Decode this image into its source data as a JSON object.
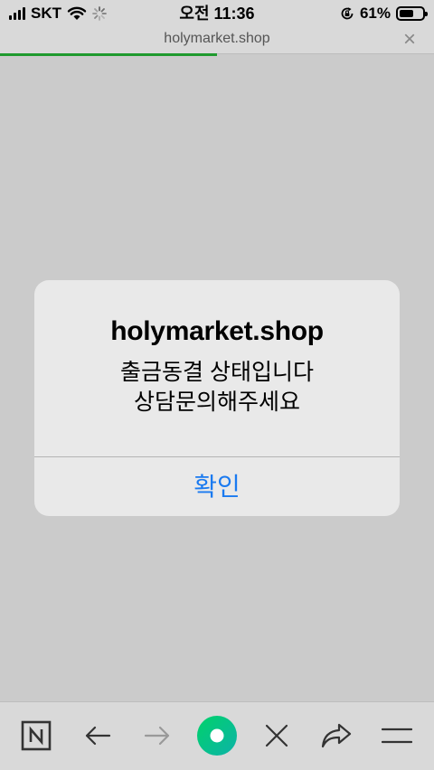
{
  "status_bar": {
    "carrier": "SKT",
    "time": "오전 11:36",
    "battery_percent": "61%",
    "battery_level": 0.61,
    "icons": [
      "signal-icon",
      "wifi-icon",
      "loading-spinner-icon",
      "rotation-lock-icon",
      "battery-icon"
    ]
  },
  "url_bar": {
    "url": "holymarket.shop",
    "close_label": "×",
    "load_progress": 0.5
  },
  "alert": {
    "title": "holymarket.shop",
    "message": "출금동결 상태입니다\n상담문의해주세요",
    "confirm_label": "확인"
  },
  "toolbar": {
    "items": [
      "naver-home-icon",
      "back-arrow-icon",
      "forward-arrow-icon",
      "green-dot-icon",
      "close-icon",
      "share-icon",
      "menu-icon"
    ]
  },
  "colors": {
    "background_dim": "#cbcbcb",
    "accent_blue": "#1a7af0",
    "progress_green": "#1f9a2e",
    "brand_green": "#03c75a"
  }
}
